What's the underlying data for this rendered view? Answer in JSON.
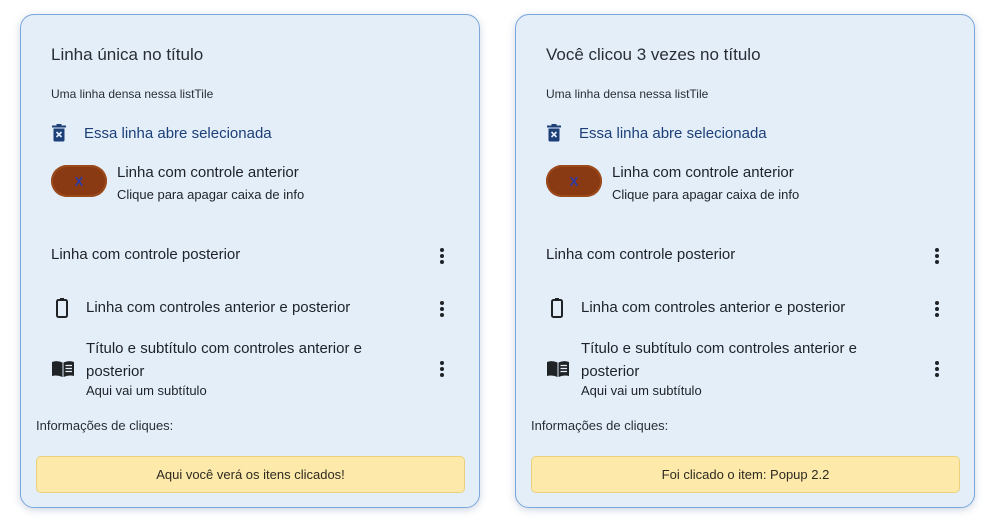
{
  "cards": [
    {
      "title": "Linha única no título",
      "dense_line": "Uma linha densa nessa listTile",
      "selected_line": "Essa linha abre selecionada",
      "leading_control_label": "X",
      "leading_title": "Linha com controle anterior",
      "leading_subtitle": "Clique para apagar caixa de info",
      "trailing_title": "Linha com controle posterior",
      "both_title": "Linha com controles anterior e posterior",
      "book_title": "Título e subtítulo com controles anterior e posterior",
      "book_subtitle": "Aqui vai um subtítulo",
      "info_label": "Informações de cliques:",
      "info_message": "Aqui você verá os itens clicados!"
    },
    {
      "title": "Você clicou 3 vezes no título",
      "dense_line": "Uma linha densa nessa listTile",
      "selected_line": "Essa linha abre selecionada",
      "leading_control_label": "X",
      "leading_title": "Linha com controle anterior",
      "leading_subtitle": "Clique para apagar caixa de info",
      "trailing_title": "Linha com controle posterior",
      "both_title": "Linha com controles anterior e posterior",
      "book_title": "Título e subtítulo com controles anterior e posterior",
      "book_subtitle": "Aqui vai um subtítulo",
      "info_label": "Informações de cliques:",
      "info_message": "Foi clicado o item: Popup  2.2"
    }
  ],
  "icons": {
    "selected_line": "delete-forever-icon",
    "both_line": "battery-icon",
    "book_line": "menu-book-icon",
    "trailing_menu": "more-vert-icon"
  },
  "colors": {
    "card_bg": "#e3eef9",
    "card_border": "#7ba7dd",
    "selected_text": "#1c3f78",
    "pill_bg": "#8a3a12",
    "info_bg": "#fde9a9"
  }
}
